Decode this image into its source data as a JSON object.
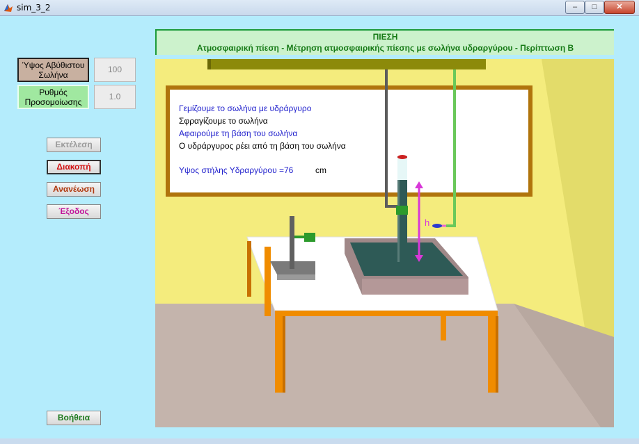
{
  "window": {
    "title": "sim_3_2",
    "minimize": "‒",
    "maximize": "□",
    "close": "✕"
  },
  "params": {
    "height_label": "Ύψος Αβύθιστου Σωλήνα",
    "height_value": "100",
    "rate_label": "Ρυθμός Προσομοίωσης",
    "rate_value": "1.0"
  },
  "buttons": {
    "run": "Εκτέλεση",
    "stop": "Διακοπή",
    "refresh": "Ανανέωση",
    "exit": "Έξοδος",
    "help": "Βοήθεια"
  },
  "scene": {
    "title": "ΠΙΕΣΗ",
    "subtitle": "Ατμοσφαιρική πίεση - Μέτρηση ατμοσφαιρικής πίεσης με σωλήνα υδραργύρου  - Περίπτωση Β",
    "board": {
      "line1": "Γεμίζουμε το σωλήνα με υδράργυρο",
      "line2": "Σφραγίζουμε το σωλήνα",
      "line3": "Αφαιρούμε τη βάση του σωλήνα",
      "line4": "Ο υδράργυρος ρέει από τη βάση του σωλήνα",
      "column_label": "Υψος στήλης Υδραργύρου =76",
      "column_unit": "cm"
    },
    "h_label": "h"
  },
  "colors": {
    "background": "#b4ecfc",
    "wall": "#f4ec7d",
    "floor": "#c4b4ac",
    "table_top": "#ffffff",
    "table_legs": "#f08c00",
    "mercury": "#2e5a56",
    "tray": "#a08888",
    "arrow": "#d838d8",
    "board_frame": "#b0740c",
    "text_blue": "#1e1ecc",
    "height_label_bg": "#c8b0a0",
    "rate_label_bg": "#a0e8a0"
  }
}
